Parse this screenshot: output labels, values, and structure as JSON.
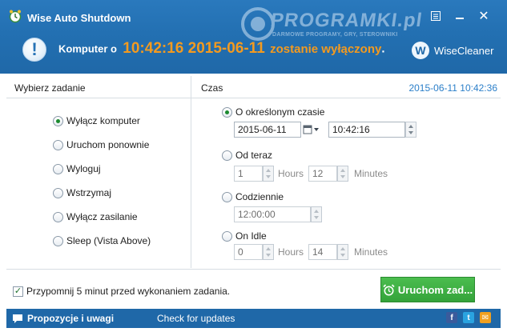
{
  "window": {
    "title": "Wise Auto Shutdown",
    "brand": "WiseCleaner",
    "brand_logo_letter": "W",
    "watermark": {
      "name": "PROGRAMKI.pl",
      "tagline": "DARMOWE PROGRAMY, GRY, STEROWNIKI"
    },
    "close_glyph": "✕"
  },
  "status": {
    "prefix": "Komputer o",
    "time": "10:42:16 2015-06-11",
    "suffix": "zostanie wyłączony",
    "end": ".",
    "info_glyph": "!"
  },
  "left_panel": {
    "header": "Wybierz zadanie",
    "tasks": [
      {
        "label": "Wyłącz komputer",
        "checked": true
      },
      {
        "label": "Uruchom ponownie",
        "checked": false
      },
      {
        "label": "Wyloguj",
        "checked": false
      },
      {
        "label": "Wstrzymaj",
        "checked": false
      },
      {
        "label": "Wyłącz zasilanie",
        "checked": false
      },
      {
        "label": "Sleep (Vista Above)",
        "checked": false
      }
    ]
  },
  "right_panel": {
    "header": "Czas",
    "current_datetime": "2015-06-11 10:42:36",
    "at_time": {
      "label": "O określonym czasie",
      "checked": true,
      "date": "2015-06-11",
      "time": "10:42:16"
    },
    "from_now": {
      "label": "Od teraz",
      "checked": false,
      "hours": "1",
      "hours_unit": "Hours",
      "minutes": "12",
      "minutes_unit": "Minutes"
    },
    "daily": {
      "label": "Codziennie",
      "checked": false,
      "time": "12:00:00"
    },
    "on_idle": {
      "label": "On Idle",
      "checked": false,
      "hours": "0",
      "hours_unit": "Hours",
      "minutes": "14",
      "minutes_unit": "Minutes"
    }
  },
  "bottom": {
    "reminder_label": "Przypomnij 5 minut przed wykonaniem zadania.",
    "reminder_checked": true,
    "check_glyph": "✓",
    "start_button": "Uruchom zad..."
  },
  "footer": {
    "feedback": "Propozycje i uwagi",
    "check_updates": "Check for updates",
    "facebook_glyph": "f",
    "twitter_glyph": "t",
    "mail_glyph": "✉"
  },
  "colors": {
    "header_blue": "#1f68a8",
    "accent_orange": "#f39a1f",
    "link_blue": "#2b7fc9",
    "button_green": "#3aa83f"
  }
}
